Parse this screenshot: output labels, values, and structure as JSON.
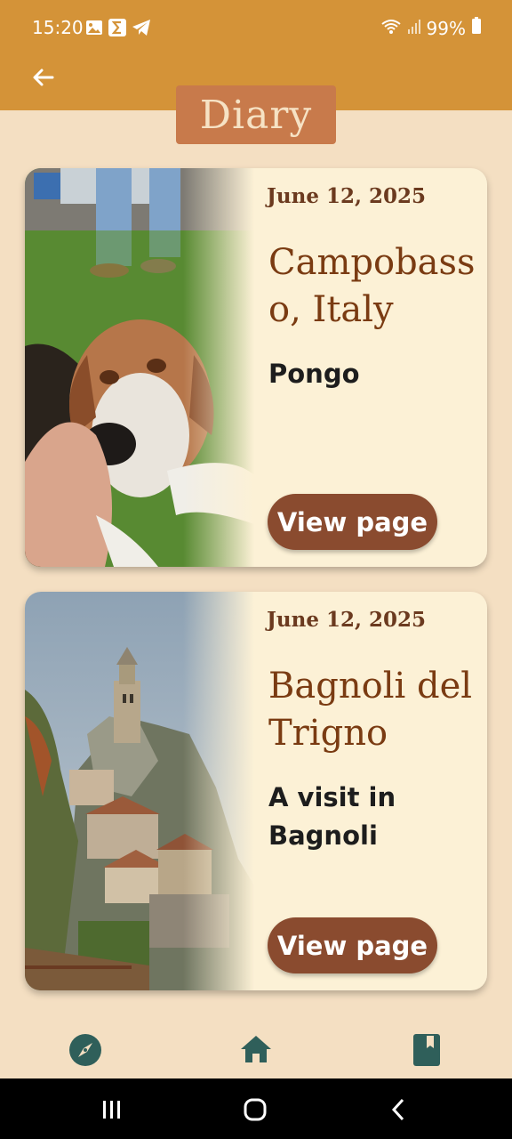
{
  "status_bar": {
    "time": "15:20",
    "battery": "99%",
    "left_icons": [
      "image-icon",
      "sigma-icon",
      "telegram-icon"
    ],
    "right_icons": [
      "wifi-icon",
      "signal-icon",
      "battery-icon"
    ]
  },
  "app_bar": {
    "back_icon": "arrow-left-icon",
    "color": "#d49338"
  },
  "page": {
    "title": "Diary",
    "title_bg": "#c87a4b",
    "background": "#f4dfc2"
  },
  "cards": [
    {
      "date": "June 12, 2025",
      "place": "Campobasso, Italy",
      "subtitle": "Pongo",
      "button": "View page",
      "image": "dog-photo"
    },
    {
      "date": "June 12, 2025",
      "place": "Bagnoli del Trigno",
      "subtitle": "A visit in Bagnoli",
      "button": "View page",
      "image": "village-photo"
    }
  ],
  "bottom_nav": {
    "items": [
      "compass-icon",
      "home-icon",
      "bookmark-book-icon"
    ],
    "icon_color": "#2f5f5a"
  },
  "system_nav": [
    "recents-icon",
    "home-circle-icon",
    "back-chevron-icon"
  ],
  "colors": {
    "card_bg": "#fcf1d6",
    "button_bg": "#8a4b2f",
    "text_brown": "#7a3b12"
  }
}
